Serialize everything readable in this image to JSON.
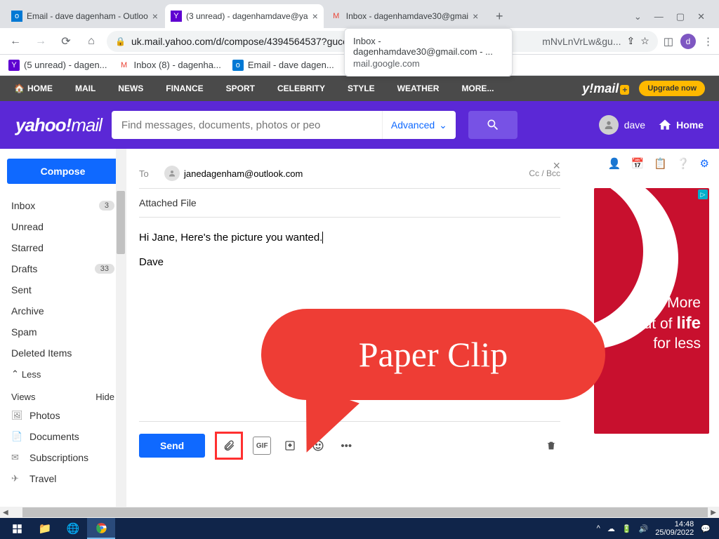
{
  "browser": {
    "tabs": [
      {
        "title": "Email - dave dagenham - Outloo",
        "favicon": "outlook"
      },
      {
        "title": "(3 unread) - dagenhamdave@ya",
        "favicon": "yahoo"
      },
      {
        "title": "Inbox - dagenhamdave30@gmai",
        "favicon": "gmail"
      }
    ],
    "url": "uk.mail.yahoo.com/d/compose/4394564537?guce",
    "url_suffix": "mNvLnVrLw&gu...",
    "tooltip_title": "Inbox - dagenhamdave30@gmail.com - ...",
    "tooltip_host": "mail.google.com",
    "profile_letter": "d"
  },
  "bookmarks": [
    {
      "label": "(5 unread) - dagen...",
      "icon": "yahoo"
    },
    {
      "label": "Inbox (8) - dagenha...",
      "icon": "gmail"
    },
    {
      "label": "Email - dave dagen...",
      "icon": "outlook"
    },
    {
      "label": "",
      "icon": "facebook"
    }
  ],
  "ynav": {
    "items": [
      "HOME",
      "MAIL",
      "NEWS",
      "FINANCE",
      "SPORT",
      "CELEBRITY",
      "STYLE",
      "WEATHER",
      "MORE..."
    ],
    "logo": "y!mail",
    "upgrade": "Upgrade now"
  },
  "yheader": {
    "logo": "yahoo!",
    "logo2": "mail",
    "search_placeholder": "Find messages, documents, photos or peo",
    "advanced": "Advanced",
    "user": "dave",
    "home": "Home"
  },
  "sidebar": {
    "compose": "Compose",
    "folders": [
      {
        "name": "Inbox",
        "badge": "3"
      },
      {
        "name": "Unread"
      },
      {
        "name": "Starred"
      },
      {
        "name": "Drafts",
        "badge": "33"
      },
      {
        "name": "Sent"
      },
      {
        "name": "Archive"
      },
      {
        "name": "Spam"
      },
      {
        "name": "Deleted Items"
      }
    ],
    "less": "Less",
    "views_label": "Views",
    "hide": "Hide",
    "views": [
      {
        "name": "Photos",
        "icon": "🖼"
      },
      {
        "name": "Documents",
        "icon": "📄"
      },
      {
        "name": "Subscriptions",
        "icon": "✉"
      },
      {
        "name": "Travel",
        "icon": "✈"
      }
    ]
  },
  "compose": {
    "to_label": "To",
    "recipient": "janedagenham@outlook.com",
    "ccbcc": "Cc / Bcc",
    "subject": "Attached File",
    "body_line1": "Hi Jane, Here's the picture you wanted.",
    "body_line2": "Dave",
    "send": "Send"
  },
  "ad": {
    "line1": "More",
    "line2_a": "out of ",
    "line2_b": "life",
    "line3": "for less"
  },
  "callout": "Paper Clip",
  "taskbar": {
    "time": "14:48",
    "date": "25/09/2022"
  }
}
